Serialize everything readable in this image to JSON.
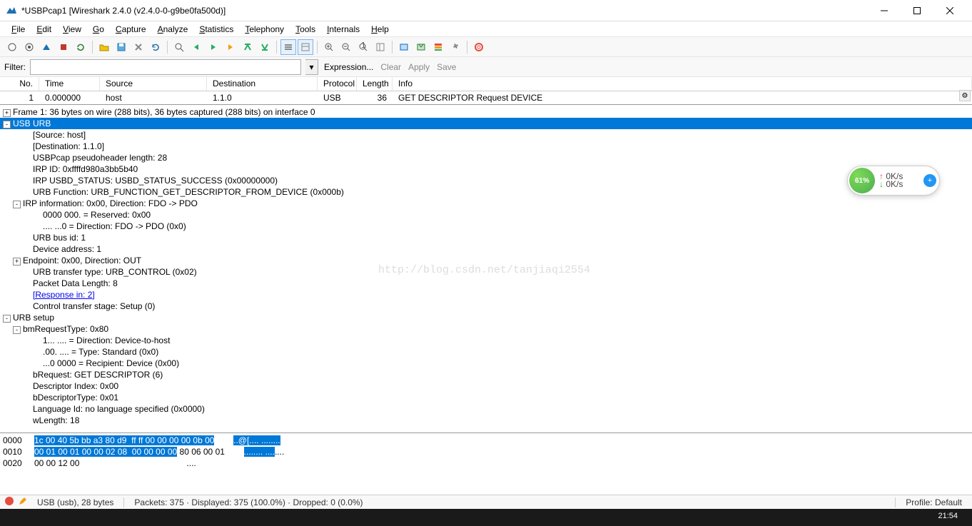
{
  "title": "*USBPcap1 [Wireshark 2.4.0 (v2.4.0-0-g9be0fa500d)]",
  "menus": [
    "File",
    "Edit",
    "View",
    "Go",
    "Capture",
    "Analyze",
    "Statistics",
    "Telephony",
    "Tools",
    "Internals",
    "Help"
  ],
  "filter": {
    "label": "Filter:",
    "expression": "Expression...",
    "clear": "Clear",
    "apply": "Apply",
    "save": "Save"
  },
  "packet_cols": {
    "no": "No.",
    "time": "Time",
    "src": "Source",
    "dst": "Destination",
    "proto": "Protocol",
    "len": "Length",
    "info": "Info"
  },
  "packet_row": {
    "no": "1",
    "time": "0.000000",
    "src": "host",
    "dst": "1.1.0",
    "proto": "USB",
    "len": "36",
    "info": "GET DESCRIPTOR Request DEVICE"
  },
  "tree": [
    {
      "exp": "+",
      "ind": 0,
      "t": "Frame 1: 36 bytes on wire (288 bits), 36 bytes captured (288 bits) on interface 0"
    },
    {
      "exp": "-",
      "ind": 0,
      "t": "USB URB",
      "sel": true
    },
    {
      "ind": 2,
      "t": "[Source: host]"
    },
    {
      "ind": 2,
      "t": "[Destination: 1.1.0]"
    },
    {
      "ind": 2,
      "t": "USBPcap pseudoheader length: 28"
    },
    {
      "ind": 2,
      "t": "IRP ID: 0xffffd980a3bb5b40"
    },
    {
      "ind": 2,
      "t": "IRP USBD_STATUS: USBD_STATUS_SUCCESS (0x00000000)"
    },
    {
      "ind": 2,
      "t": "URB Function: URB_FUNCTION_GET_DESCRIPTOR_FROM_DEVICE (0x000b)"
    },
    {
      "exp": "-",
      "ind": 1,
      "t": "IRP information: 0x00, Direction: FDO -> PDO"
    },
    {
      "ind": 3,
      "t": "0000 000. = Reserved: 0x00"
    },
    {
      "ind": 3,
      "t": ".... ...0 = Direction: FDO -> PDO (0x0)"
    },
    {
      "ind": 2,
      "t": "URB bus id: 1"
    },
    {
      "ind": 2,
      "t": "Device address: 1"
    },
    {
      "exp": "+",
      "ind": 1,
      "t": "Endpoint: 0x00, Direction: OUT"
    },
    {
      "ind": 2,
      "t": "URB transfer type: URB_CONTROL (0x02)"
    },
    {
      "ind": 2,
      "t": "Packet Data Length: 8"
    },
    {
      "ind": 2,
      "link": true,
      "t": "[Response in: 2]"
    },
    {
      "ind": 2,
      "t": "Control transfer stage: Setup (0)"
    },
    {
      "exp": "-",
      "ind": 0,
      "t": "URB setup"
    },
    {
      "exp": "-",
      "ind": 1,
      "t": "bmRequestType: 0x80"
    },
    {
      "ind": 3,
      "t": "1... .... = Direction: Device-to-host"
    },
    {
      "ind": 3,
      "t": ".00. .... = Type: Standard (0x0)"
    },
    {
      "ind": 3,
      "t": "...0 0000 = Recipient: Device (0x00)"
    },
    {
      "ind": 2,
      "t": "bRequest: GET DESCRIPTOR (6)"
    },
    {
      "ind": 2,
      "t": "Descriptor Index: 0x00"
    },
    {
      "ind": 2,
      "t": "bDescriptorType: 0x01"
    },
    {
      "ind": 2,
      "t": "Language Id: no language specified (0x0000)"
    },
    {
      "ind": 2,
      "t": "wLength: 18"
    }
  ],
  "hex": [
    {
      "off": "0000",
      "sel1": "1c 00 40 5b bb a3 80 d9  ff ff 00 00 00 00 0b 00",
      "plain1": "",
      "asel": "..@[.... ........",
      "aplain": ""
    },
    {
      "off": "0010",
      "sel1": "00 01 00 01 00 00 02 08  00 00 00 00",
      "plain1": " 80 06 00 01",
      "asel": "........ ....",
      "aplain": "...."
    },
    {
      "off": "0020",
      "sel1": "",
      "plain1": "00 00 12 00",
      "asel": "",
      "aplain": "...."
    }
  ],
  "status": {
    "left": "USB (usb), 28 bytes",
    "mid": "Packets: 375 · Displayed: 375 (100.0%) · Dropped: 0 (0.0%)",
    "right": "Profile: Default"
  },
  "meter": {
    "pct": "61%",
    "up": "0K/s",
    "down": "0K/s"
  },
  "watermark": "http://blog.csdn.net/tanjiaqi2554",
  "clock": "21:54"
}
